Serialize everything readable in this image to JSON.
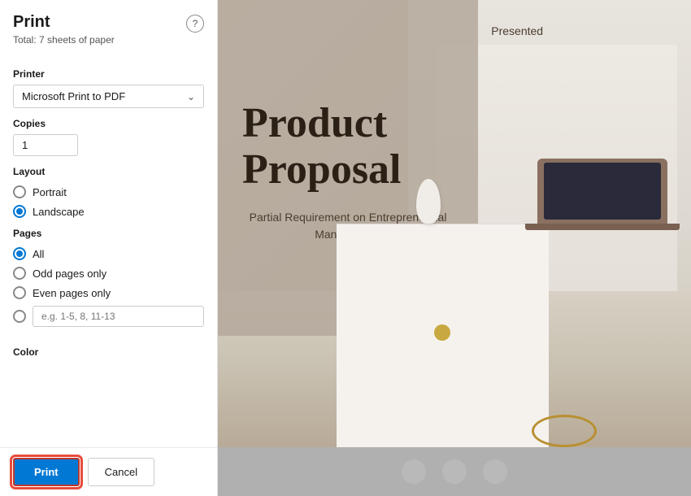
{
  "header": {
    "title": "Print",
    "subtitle": "Total: 7 sheets of paper",
    "help_label": "?"
  },
  "printer_section": {
    "label": "Printer",
    "selected_value": "Microsoft Print to PDF"
  },
  "copies_section": {
    "label": "Copies",
    "value": "1"
  },
  "layout_section": {
    "label": "Layout",
    "options": [
      {
        "id": "portrait",
        "label": "Portrait",
        "checked": false
      },
      {
        "id": "landscape",
        "label": "Landscape",
        "checked": true
      }
    ]
  },
  "pages_section": {
    "label": "Pages",
    "options": [
      {
        "id": "all",
        "label": "All",
        "checked": true
      },
      {
        "id": "odd",
        "label": "Odd pages only",
        "checked": false
      },
      {
        "id": "even",
        "label": "Even pages only",
        "checked": false
      },
      {
        "id": "custom",
        "label": "",
        "checked": false
      }
    ],
    "custom_placeholder": "e.g. 1-5, 8, 11-13"
  },
  "color_section": {
    "label": "Color"
  },
  "footer": {
    "print_label": "Print",
    "cancel_label": "Cancel"
  },
  "preview": {
    "slide_title": "Product Proposal",
    "slide_presented": "Presented",
    "slide_subtitle": "Partial Requirement on Entrepreneurial Management"
  }
}
